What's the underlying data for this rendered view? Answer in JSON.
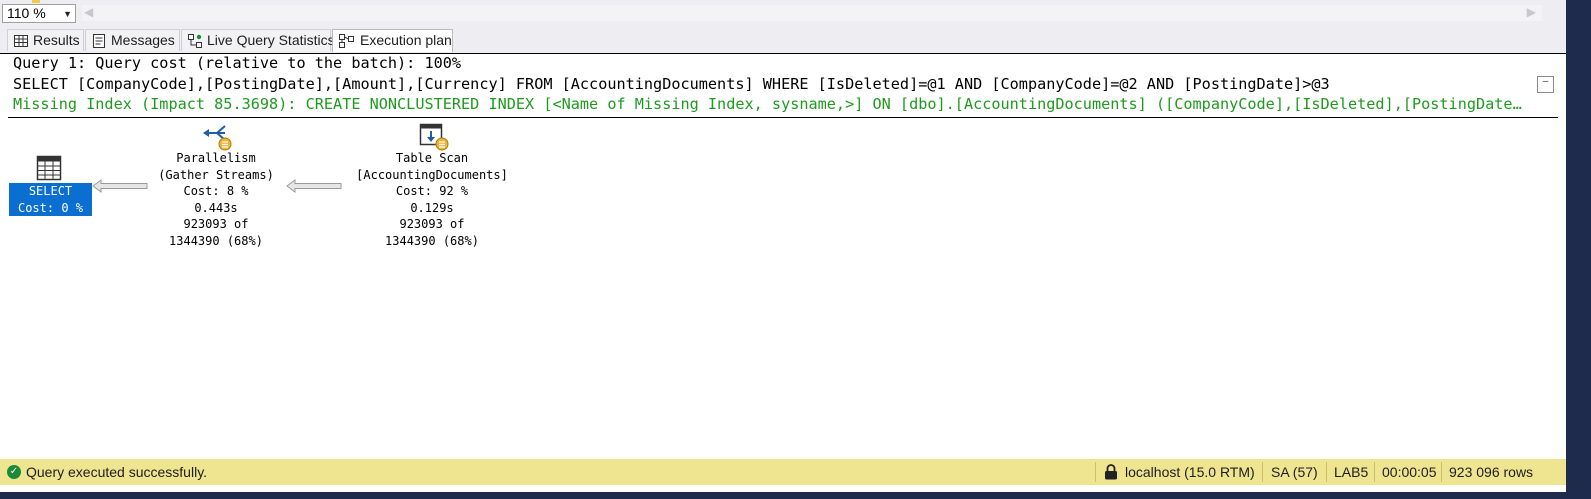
{
  "toolbar": {
    "zoom_value": "110 %"
  },
  "tabs": [
    {
      "label": "Results",
      "icon": "grid-icon"
    },
    {
      "label": "Messages",
      "icon": "messages-icon"
    },
    {
      "label": "Live Query Statistics",
      "icon": "live-stats-icon"
    },
    {
      "label": "Execution plan",
      "icon": "execution-plan-icon",
      "active": true
    }
  ],
  "query": {
    "header": "Query 1: Query cost (relative to the batch): 100%",
    "sql": "SELECT [CompanyCode],[PostingDate],[Amount],[Currency] FROM [AccountingDocuments] WHERE [IsDeleted]=@1 AND [CompanyCode]=@2 AND [PostingDate]>@3",
    "missing_index": "Missing Index (Impact 85.3698): CREATE NONCLUSTERED INDEX [<Name of Missing Index, sysname,>] ON [dbo].[AccountingDocuments] ([CompanyCode],[IsDeleted],[PostingDate]) INCLUDE ([Amount],[Currency])"
  },
  "plan": {
    "select_node": {
      "line1": "SELECT",
      "line2": "Cost: 0 %"
    },
    "parallelism_node": {
      "name": "Parallelism",
      "subtitle": "(Gather Streams)",
      "cost": "Cost: 8 %",
      "time": "0.443s",
      "rows": "923093 of",
      "estimate": "1344390 (68%)"
    },
    "table_scan_node": {
      "name": "Table Scan",
      "object": "[AccountingDocuments]",
      "cost": "Cost: 92 %",
      "time": "0.129s",
      "rows": "923093 of",
      "estimate": "1344390 (68%)"
    }
  },
  "status_bar": {
    "message": "Query executed successfully.",
    "server": "localhost (15.0 RTM)",
    "user": "SA (57)",
    "database": "LAB5",
    "elapsed": "00:00:05",
    "rows": "923 096 rows"
  },
  "colors": {
    "status_bar_bg": "#efe48f",
    "missing_index_text": "#1f9a1f",
    "selected_node_bg": "#0a6fd1",
    "frame": "#1e2b4d"
  }
}
